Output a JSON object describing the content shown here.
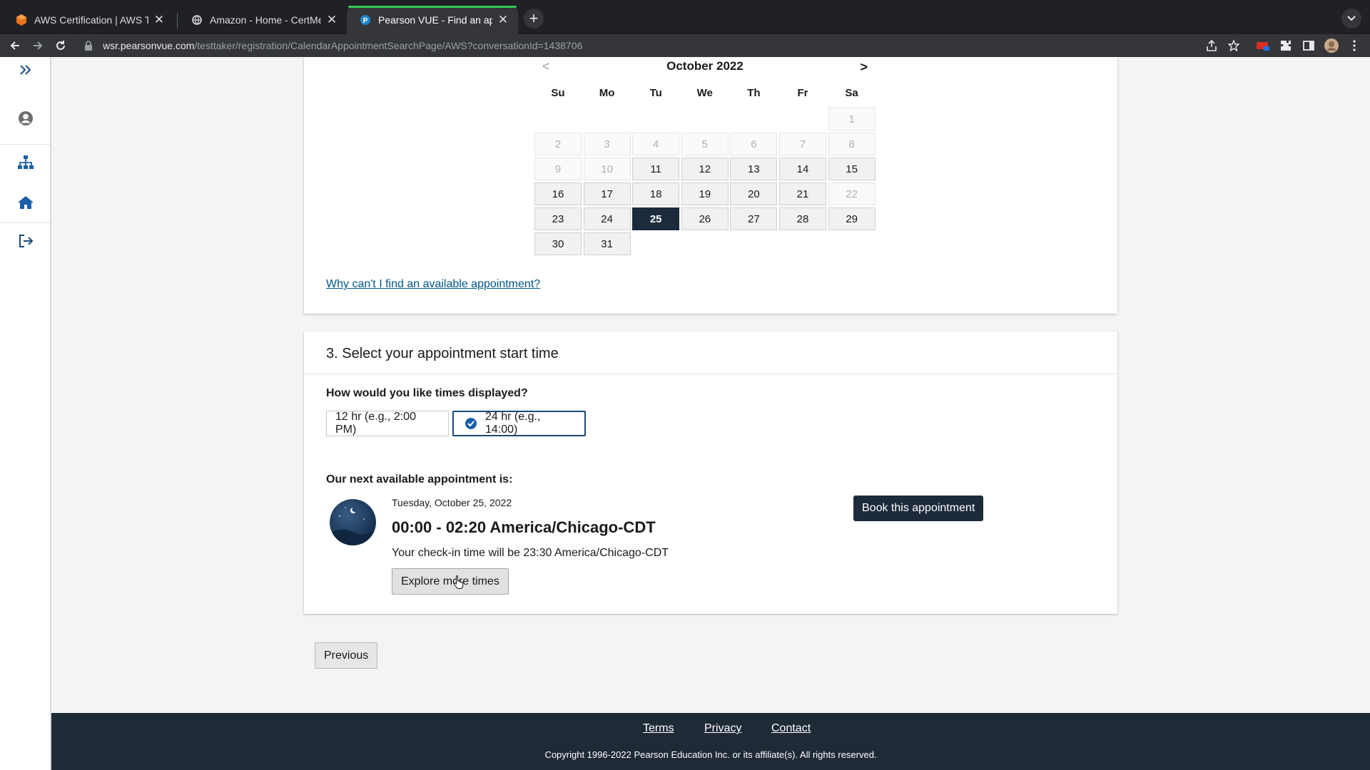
{
  "browser": {
    "tabs": [
      {
        "title": "AWS Certification | AWS Trainin",
        "favicon": "aws-icon"
      },
      {
        "title": "Amazon - Home - CertMetrics",
        "favicon": "globe-icon"
      },
      {
        "title": "Pearson VUE - Find an appoint",
        "favicon": "pearson-icon",
        "active": true
      }
    ],
    "url_host": "wsr.pearsonvue.com",
    "url_path": "/testtaker/registration/CalendarAppointmentSearchPage/AWS?conversationId=1438706"
  },
  "sidebar": {
    "items": [
      "expand-icon",
      "account-icon",
      "sitemap-icon",
      "home-icon",
      "sign-out-icon"
    ]
  },
  "calendar": {
    "month_label": "October 2022",
    "prev": "<",
    "next": ">",
    "weekdays": [
      "Su",
      "Mo",
      "Tu",
      "We",
      "Th",
      "Fr",
      "Sa"
    ],
    "first_weekday_index": 6,
    "days": 31,
    "disabled_days": [
      1,
      2,
      3,
      4,
      5,
      6,
      7,
      8,
      9,
      10,
      22
    ],
    "selected_day": 25
  },
  "help_link": "Why can't I find an available appointment?",
  "time_section": {
    "title": "3. Select your appointment start time",
    "question": "How would you like times displayed?",
    "format_12": "12 hr (e.g., 2:00 PM)",
    "format_24": "24 hr (e.g., 14:00)",
    "selected_format": "24"
  },
  "next_appointment": {
    "label": "Our next available appointment is:",
    "date": "Tuesday, October 25, 2022",
    "time": "00:00 - 02:20 America/Chicago-CDT",
    "checkin": "Your check-in time will be 23:30 America/Chicago-CDT",
    "explore": "Explore more times",
    "book": "Book this appointment"
  },
  "nav": {
    "previous": "Previous"
  },
  "footer": {
    "links": [
      "Terms",
      "Privacy",
      "Contact"
    ],
    "copyright": "Copyright 1996-2022 Pearson Education Inc. or its affiliate(s). All rights reserved."
  },
  "colors": {
    "brand_dark": "#1c2a3b",
    "link": "#005587",
    "footer_bg": "#1f2a37",
    "check_blue": "#1b5fa8"
  }
}
